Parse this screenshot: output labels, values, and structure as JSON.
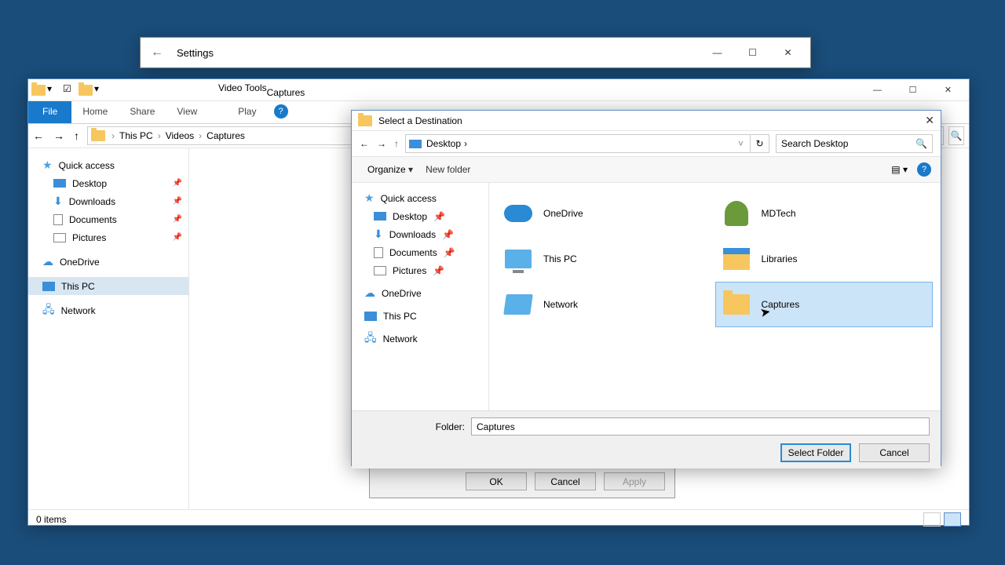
{
  "settings": {
    "title": "Settings"
  },
  "explorer": {
    "context_tab": "Video Tools",
    "title_tab": "Captures",
    "ribbon": {
      "file": "File",
      "home": "Home",
      "share": "Share",
      "view": "View",
      "play": "Play"
    },
    "breadcrumb": [
      "This PC",
      "Videos",
      "Captures"
    ],
    "tree": {
      "quick": "Quick access",
      "desktop": "Desktop",
      "downloads": "Downloads",
      "documents": "Documents",
      "pictures": "Pictures",
      "onedrive": "OneDrive",
      "thispc": "This PC",
      "network": "Network"
    },
    "status": "0 items"
  },
  "dialog": {
    "title": "Select a Destination",
    "location": "Desktop",
    "search_placeholder": "Search Desktop",
    "organize": "Organize",
    "newfolder": "New folder",
    "tree": {
      "quick": "Quick access",
      "desktop": "Desktop",
      "downloads": "Downloads",
      "documents": "Documents",
      "pictures": "Pictures",
      "onedrive": "OneDrive",
      "thispc": "This PC",
      "network": "Network"
    },
    "items": {
      "onedrive": "OneDrive",
      "mdtech": "MDTech",
      "thispc": "This PC",
      "libraries": "Libraries",
      "network": "Network",
      "captures": "Captures"
    },
    "folder_label": "Folder:",
    "folder_value": "Captures",
    "select": "Select Folder",
    "cancel": "Cancel"
  },
  "prop": {
    "ok": "OK",
    "cancel": "Cancel",
    "apply": "Apply"
  }
}
